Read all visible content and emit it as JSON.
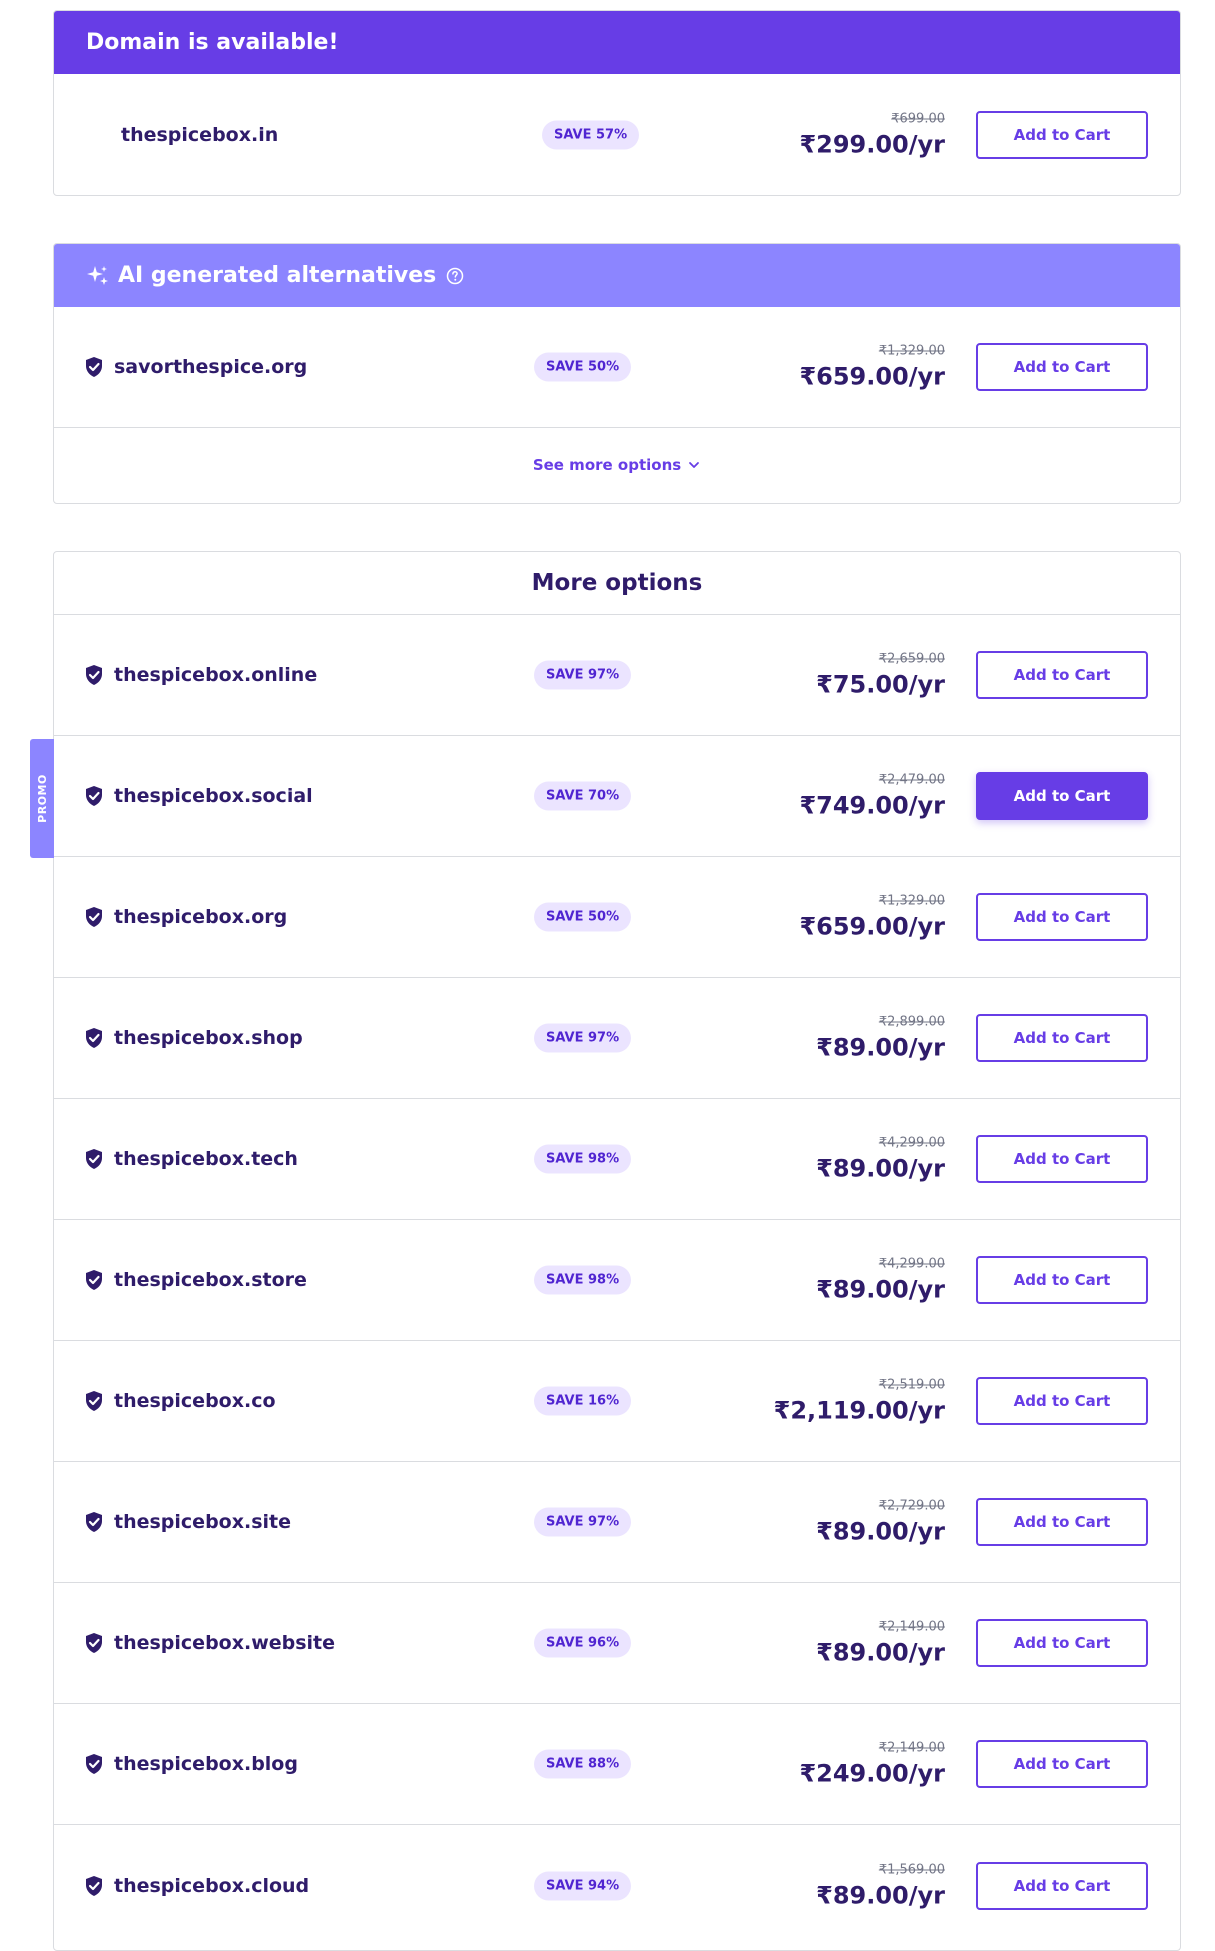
{
  "available": {
    "title": "Domain is available!",
    "domain": "thespicebox.in",
    "badge": "SAVE 57%",
    "old_price": "₹699.00",
    "price": "₹299.00/yr",
    "button": "Add to Cart"
  },
  "ai": {
    "title": "AI generated alternatives",
    "domain": "savorthespice.org",
    "badge": "SAVE 50%",
    "old_price": "₹1,329.00",
    "price": "₹659.00/yr",
    "button": "Add to Cart",
    "see_more": "See more options"
  },
  "more": {
    "title": "More options",
    "rows": [
      {
        "domain": "thespicebox.online",
        "badge": "SAVE 97%",
        "old_price": "₹2,659.00",
        "price": "₹75.00/yr",
        "button": "Add to Cart"
      },
      {
        "domain": "thespicebox.social",
        "badge": "SAVE 70%",
        "old_price": "₹2,479.00",
        "price": "₹749.00/yr",
        "button": "Add to Cart"
      },
      {
        "domain": "thespicebox.org",
        "badge": "SAVE 50%",
        "old_price": "₹1,329.00",
        "price": "₹659.00/yr",
        "button": "Add to Cart"
      },
      {
        "domain": "thespicebox.shop",
        "badge": "SAVE 97%",
        "old_price": "₹2,899.00",
        "price": "₹89.00/yr",
        "button": "Add to Cart"
      },
      {
        "domain": "thespicebox.tech",
        "badge": "SAVE 98%",
        "old_price": "₹4,299.00",
        "price": "₹89.00/yr",
        "button": "Add to Cart"
      },
      {
        "domain": "thespicebox.store",
        "badge": "SAVE 98%",
        "old_price": "₹4,299.00",
        "price": "₹89.00/yr",
        "button": "Add to Cart"
      },
      {
        "domain": "thespicebox.co",
        "badge": "SAVE 16%",
        "old_price": "₹2,519.00",
        "price": "₹2,119.00/yr",
        "button": "Add to Cart"
      },
      {
        "domain": "thespicebox.site",
        "badge": "SAVE 97%",
        "old_price": "₹2,729.00",
        "price": "₹89.00/yr",
        "button": "Add to Cart"
      },
      {
        "domain": "thespicebox.website",
        "badge": "SAVE 96%",
        "old_price": "₹2,149.00",
        "price": "₹89.00/yr",
        "button": "Add to Cart"
      },
      {
        "domain": "thespicebox.blog",
        "badge": "SAVE 88%",
        "old_price": "₹2,149.00",
        "price": "₹249.00/yr",
        "button": "Add to Cart"
      },
      {
        "domain": "thespicebox.cloud",
        "badge": "SAVE 94%",
        "old_price": "₹1,569.00",
        "price": "₹89.00/yr",
        "button": "Add to Cart"
      }
    ]
  },
  "promo_tab": "PROMO",
  "icons": {
    "shield": "shield-check-icon",
    "sparkle": "sparkle-icon",
    "help": "help-circle-icon",
    "chevron": "chevron-down-icon"
  },
  "colors": {
    "primary": "#673de6",
    "ai_header": "#8c85ff",
    "text": "#2f1c6a",
    "badge_bg": "#ebe4ff"
  }
}
